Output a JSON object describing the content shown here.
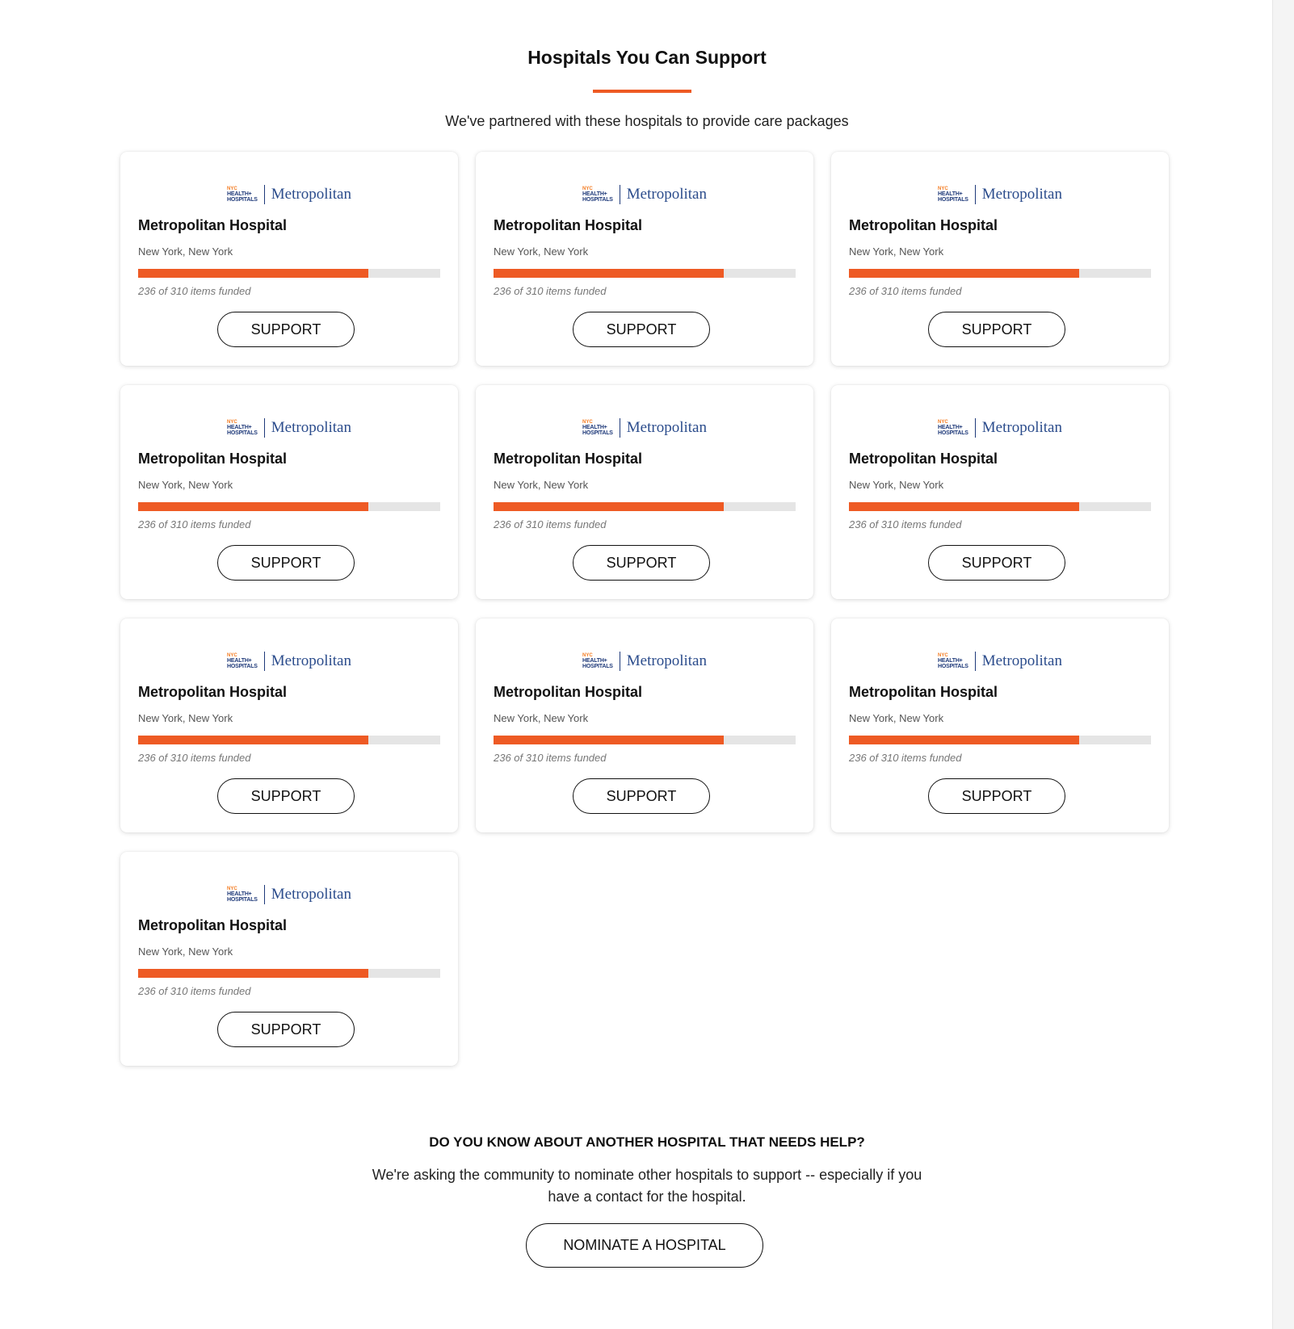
{
  "header": {
    "title": "Hospitals You Can Support",
    "subtitle": "We've partnered with these hospitals to provide care packages"
  },
  "colors": {
    "accent": "#ee5a24",
    "logo_navy": "#1f3a7a",
    "logo_orange": "#f47b20"
  },
  "hospitals": [
    {
      "logo_nyc": "NYC",
      "logo_hh1": "HEALTH+",
      "logo_hh2": "HOSPITALS",
      "logo_word": "Metropolitan",
      "name": "Metropolitan Hospital",
      "location": "New York, New York",
      "funded_text": "236 of 310 items funded",
      "funded": 236,
      "total": 310,
      "button_label": "SUPPORT"
    },
    {
      "logo_nyc": "NYC",
      "logo_hh1": "HEALTH+",
      "logo_hh2": "HOSPITALS",
      "logo_word": "Metropolitan",
      "name": "Metropolitan Hospital",
      "location": "New York, New York",
      "funded_text": "236 of 310 items funded",
      "funded": 236,
      "total": 310,
      "button_label": "SUPPORT"
    },
    {
      "logo_nyc": "NYC",
      "logo_hh1": "HEALTH+",
      "logo_hh2": "HOSPITALS",
      "logo_word": "Metropolitan",
      "name": "Metropolitan Hospital",
      "location": "New York, New York",
      "funded_text": "236 of 310 items funded",
      "funded": 236,
      "total": 310,
      "button_label": "SUPPORT"
    },
    {
      "logo_nyc": "NYC",
      "logo_hh1": "HEALTH+",
      "logo_hh2": "HOSPITALS",
      "logo_word": "Metropolitan",
      "name": "Metropolitan Hospital",
      "location": "New York, New York",
      "funded_text": "236 of 310 items funded",
      "funded": 236,
      "total": 310,
      "button_label": "SUPPORT"
    },
    {
      "logo_nyc": "NYC",
      "logo_hh1": "HEALTH+",
      "logo_hh2": "HOSPITALS",
      "logo_word": "Metropolitan",
      "name": "Metropolitan Hospital",
      "location": "New York, New York",
      "funded_text": "236 of 310 items funded",
      "funded": 236,
      "total": 310,
      "button_label": "SUPPORT"
    },
    {
      "logo_nyc": "NYC",
      "logo_hh1": "HEALTH+",
      "logo_hh2": "HOSPITALS",
      "logo_word": "Metropolitan",
      "name": "Metropolitan Hospital",
      "location": "New York, New York",
      "funded_text": "236 of 310 items funded",
      "funded": 236,
      "total": 310,
      "button_label": "SUPPORT"
    },
    {
      "logo_nyc": "NYC",
      "logo_hh1": "HEALTH+",
      "logo_hh2": "HOSPITALS",
      "logo_word": "Metropolitan",
      "name": "Metropolitan Hospital",
      "location": "New York, New York",
      "funded_text": "236 of 310 items funded",
      "funded": 236,
      "total": 310,
      "button_label": "SUPPORT"
    },
    {
      "logo_nyc": "NYC",
      "logo_hh1": "HEALTH+",
      "logo_hh2": "HOSPITALS",
      "logo_word": "Metropolitan",
      "name": "Metropolitan Hospital",
      "location": "New York, New York",
      "funded_text": "236 of 310 items funded",
      "funded": 236,
      "total": 310,
      "button_label": "SUPPORT"
    },
    {
      "logo_nyc": "NYC",
      "logo_hh1": "HEALTH+",
      "logo_hh2": "HOSPITALS",
      "logo_word": "Metropolitan",
      "name": "Metropolitan Hospital",
      "location": "New York, New York",
      "funded_text": "236 of 310 items funded",
      "funded": 236,
      "total": 310,
      "button_label": "SUPPORT"
    },
    {
      "logo_nyc": "NYC",
      "logo_hh1": "HEALTH+",
      "logo_hh2": "HOSPITALS",
      "logo_word": "Metropolitan",
      "name": "Metropolitan Hospital",
      "location": "New York, New York",
      "funded_text": "236 of 310 items funded",
      "funded": 236,
      "total": 310,
      "button_label": "SUPPORT"
    }
  ],
  "nominate": {
    "heading": "DO YOU KNOW ABOUT ANOTHER HOSPITAL THAT NEEDS HELP?",
    "text": "We're asking the community to nominate other hospitals to support -- especially if you have a contact for the hospital.",
    "button_label": "NOMINATE A HOSPITAL"
  }
}
